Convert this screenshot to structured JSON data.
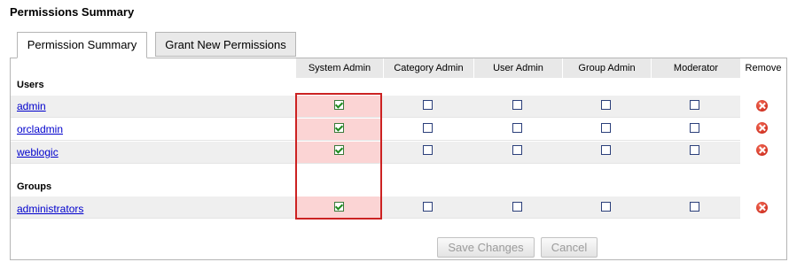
{
  "page": {
    "title": "Permissions Summary"
  },
  "tabs": [
    {
      "label": "Permission Summary",
      "active": true
    },
    {
      "label": "Grant New Permissions",
      "active": false
    }
  ],
  "columns": [
    "System Admin",
    "Category Admin",
    "User Admin",
    "Group Admin",
    "Moderator"
  ],
  "remove_header": "Remove",
  "sections": {
    "users": {
      "label": "Users",
      "rows": [
        {
          "name": "admin",
          "checks": [
            true,
            false,
            false,
            false,
            false
          ]
        },
        {
          "name": "orcladmin",
          "checks": [
            true,
            false,
            false,
            false,
            false
          ]
        },
        {
          "name": "weblogic",
          "checks": [
            true,
            false,
            false,
            false,
            false
          ]
        }
      ]
    },
    "groups": {
      "label": "Groups",
      "rows": [
        {
          "name": "administrators",
          "checks": [
            true,
            false,
            false,
            false,
            false
          ]
        }
      ]
    }
  },
  "buttons": {
    "save": "Save Changes",
    "cancel": "Cancel"
  },
  "colors": {
    "highlight_border": "#cc2222",
    "highlight_fill": "#fbd4d4",
    "link": "#0000cc"
  },
  "icons": {
    "remove": "delete-circle-icon"
  }
}
